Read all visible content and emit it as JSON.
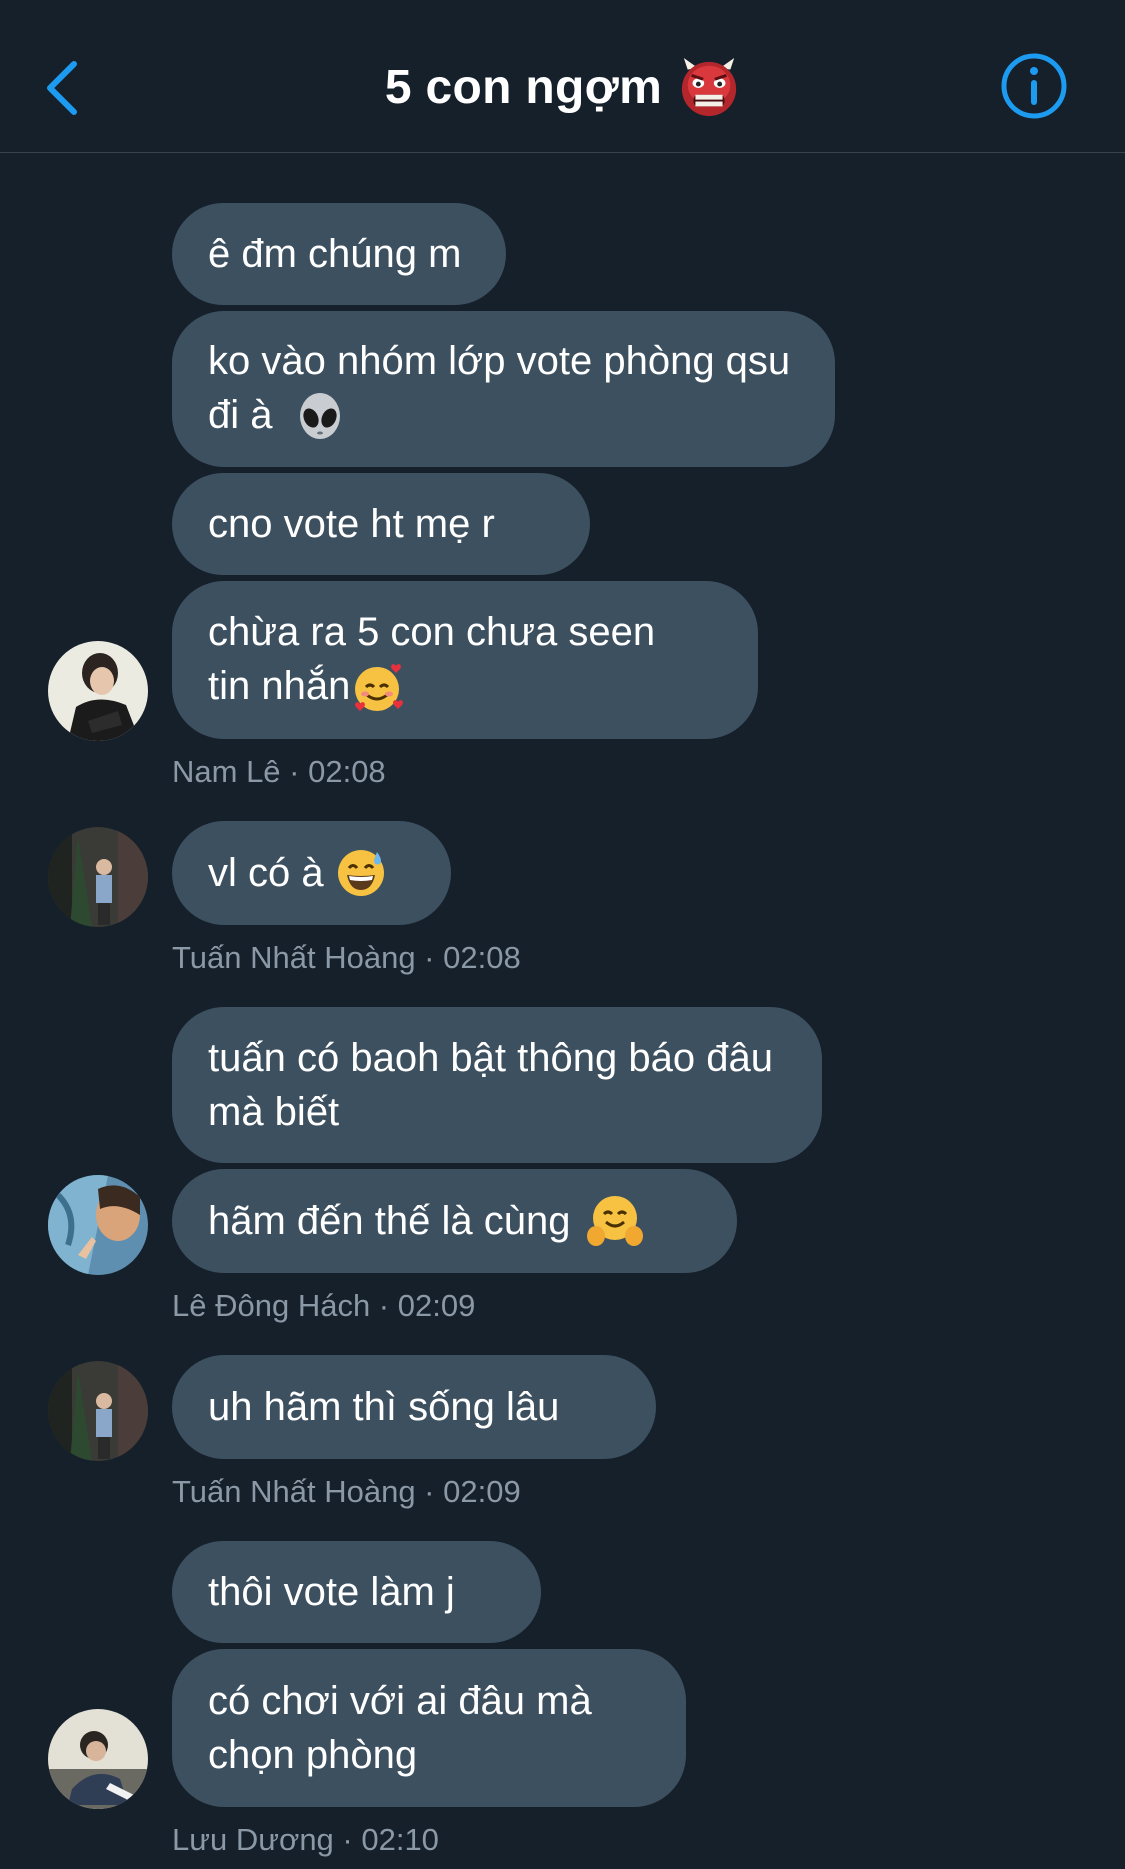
{
  "header": {
    "title": "5 con ngợm",
    "title_emoji": "ogre-emoji",
    "back_icon": "chevron-left-icon",
    "info_icon": "info-circle-icon",
    "accent_color": "#1d9bf0"
  },
  "colors": {
    "background": "#15202b",
    "bubble": "#3d5060",
    "meta_text": "#8b98a5",
    "divider": "#38444d"
  },
  "messages": [
    {
      "text": "ê đm chúng m"
    },
    {
      "text": "ko vào nhóm lớp vote phòng qsu đi à",
      "emoji": "alien-emoji"
    },
    {
      "text": "cno vote ht mẹ r"
    },
    {
      "text": "chừa ra 5 con chưa seen tin nhắn",
      "emoji": "smiling-face-with-hearts-emoji"
    },
    {
      "text": "vl có à",
      "emoji": "grinning-sweat-emoji"
    },
    {
      "text": "tuấn có baoh bật thông báo đâu mà biết"
    },
    {
      "text": "hãm đến thế là cùng",
      "emoji": "hugging-face-emoji"
    },
    {
      "text": "uh hãm thì sống lâu"
    },
    {
      "text": "thôi vote làm j"
    },
    {
      "text": "có chơi với ai đâu mà chọn phòng"
    }
  ],
  "groups": [
    {
      "sender": "Nam Lê",
      "time": "02:08",
      "meta": "Nam Lê · 02:08"
    },
    {
      "sender": "Tuấn Nhất Hoàng",
      "time": "02:08",
      "meta": "Tuấn Nhất Hoàng · 02:08"
    },
    {
      "sender": "Lê Đông Hách",
      "time": "02:09",
      "meta": "Lê Đông Hách · 02:09"
    },
    {
      "sender": "Tuấn Nhất Hoàng",
      "time": "02:09",
      "meta": "Tuấn Nhất Hoàng · 02:09"
    },
    {
      "sender": "Lưu Dương",
      "time": "02:10",
      "meta": "Lưu Dương · 02:10"
    }
  ]
}
